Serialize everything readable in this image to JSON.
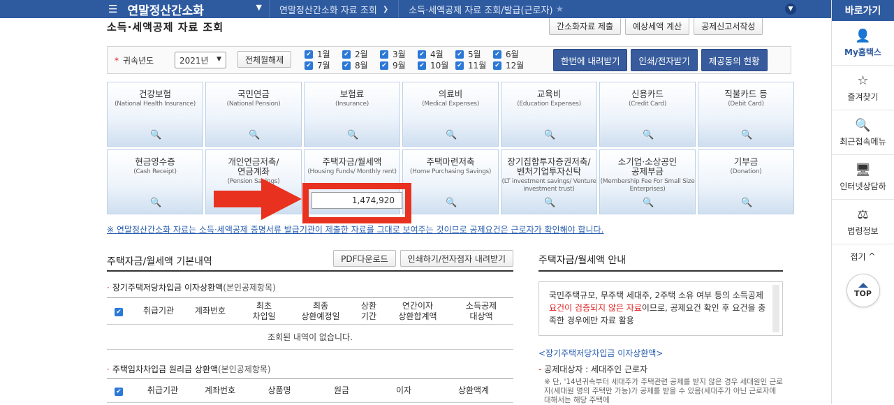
{
  "topbar": {
    "menu_title": "연말정산간소화",
    "crumbs": [
      "연말정산간소화 자료 조회",
      "소득·세액공제 자료 조회/발급(근로자)"
    ]
  },
  "sidebar": {
    "title": "바로가기",
    "items": [
      "My홈택스",
      "즐겨찾기",
      "최근접속메뉴",
      "인터넷상담하",
      "법령정보"
    ],
    "fold": "접기",
    "top": "TOP"
  },
  "page": {
    "title": "소득·세액공제 자료 조회",
    "buttons": [
      "간소화자료 제출",
      "예상세액 계산",
      "공제신고서작성"
    ]
  },
  "filter": {
    "label": "귀속년도",
    "year": "2021년",
    "unselect_all": "전체월해제",
    "months": [
      "1월",
      "2월",
      "3월",
      "4월",
      "5월",
      "6월",
      "7월",
      "8월",
      "9월",
      "10월",
      "11월",
      "12월"
    ],
    "actions": [
      "한번에 내려받기",
      "인쇄/전자받기",
      "제공동의 현황"
    ]
  },
  "cards": [
    {
      "kr": "건강보험",
      "en": "(National Health Insurance)"
    },
    {
      "kr": "국민연금",
      "en": "(National Pension)"
    },
    {
      "kr": "보험료",
      "en": "(Insurance)"
    },
    {
      "kr": "의료비",
      "en": "(Medical Expenses)"
    },
    {
      "kr": "교육비",
      "en": "(Education Expenses)"
    },
    {
      "kr": "신용카드",
      "en": "(Credit Card)"
    },
    {
      "kr": "직불카드 등",
      "en": "(Debit Card)"
    },
    {
      "kr": "현금영수증",
      "en": "(Cash Receipt)"
    },
    {
      "kr": "개인연금저축/\n연금계좌",
      "en": "(Pension Savings)"
    },
    {
      "kr": "주택자금/월세액",
      "en": "(Housing Funds/ Monthly rent)"
    },
    {
      "kr": "주택마련저축",
      "en": "(Home Purchasing Savings)"
    },
    {
      "kr": "장기집합투자증권저축/\n벤처기업투자신탁",
      "en": "(LT investment savings/ Venture investment trust)"
    },
    {
      "kr": "소기업·소상공인\n공제부금",
      "en": "(Membership Fee For Small Size Enterprises)"
    },
    {
      "kr": "기부금",
      "en": "(Donation)"
    }
  ],
  "amount": "1,474,920",
  "notice": "※ 연말정산간소화 자료는 소득·세액공제 증명서류 발급기관이 제출한 자료를 그대로 보여주는 것이므로 공제요건은 근로자가 확인해야 합니다.",
  "section": {
    "title": "주택자금/월세액 기본내역",
    "buttons": [
      "PDF다운로드",
      "인쇄하기/전자점자 내려받기"
    ],
    "sub1": {
      "title": "장기주택저당차입금 이자상환액",
      "note": "(본인공제항목)"
    },
    "table1_headers": [
      "취급기관",
      "계좌번호",
      "최초\n차입일",
      "최종\n상환예정일",
      "상환\n기간",
      "연간이자\n상환합계액",
      "소득공제\n대상액"
    ],
    "empty": "조회된 내역이 없습니다.",
    "sub2": {
      "title": "주택임차차입금 원리금 상환액",
      "note": "(본인공제항목)"
    },
    "table2_headers": [
      "취급기관",
      "계좌번호",
      "상품명",
      "원금",
      "이자",
      "상환액계"
    ]
  },
  "guide": {
    "title": "주택자금/월세액 안내",
    "box_pre": "국민주택규모, 무주택 세대주, 2주택 소유 여부 등의 소득공제 ",
    "box_red": "요건이 검증되지 않은 자료",
    "box_post": "이므로, 공제요건 확인 후 요건을 충족한 경우에만 자료 활용",
    "h2": "<장기주택저당차입금 이자상환액>",
    "h3": "공제대상자 : 세대주인 근로자",
    "note": "※ 단, '14년귀속부터 세대주가 주택관련 공제를 받지 않은 경우 세대원인 근로자(세대원 명의 주택만 가능)가 공제를 받을 수 있음(세대주가 아닌 근로자에 대해서는 해당 주택에"
  }
}
